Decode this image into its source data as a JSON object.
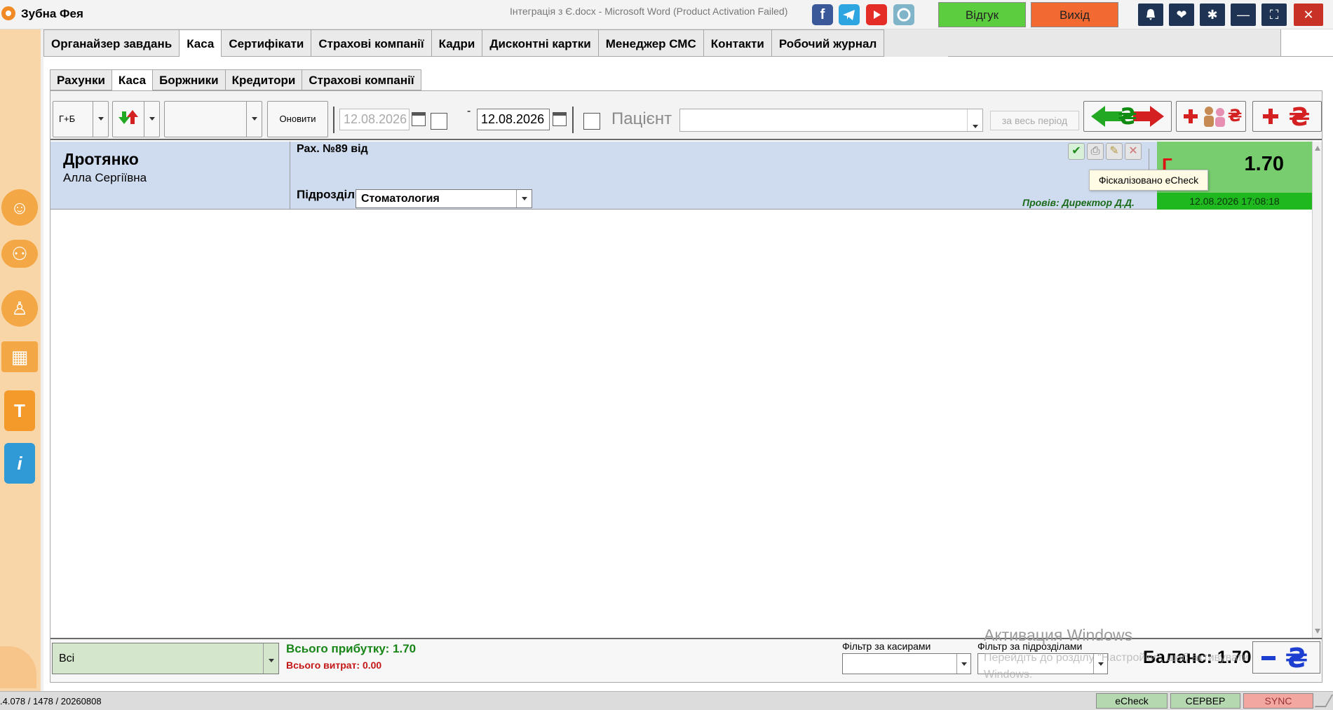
{
  "titlebar": {
    "app_name": "Зубна Фея",
    "window_title": "Інтеграція з Є.docx  -  Microsoft Word (Product Activation Failed)",
    "feedback_label": "Відгук",
    "exit_label": "Вихід",
    "feedback_color": "#5ccd3f",
    "exit_color": "#f26a32"
  },
  "main_tabs": [
    {
      "label": "Органайзер завдань"
    },
    {
      "label": "Каса",
      "active": true
    },
    {
      "label": "Сертифікати"
    },
    {
      "label": "Страхові компанії"
    },
    {
      "label": "Кадри"
    },
    {
      "label": "Дисконтні картки"
    },
    {
      "label": "Менеджер СМС"
    },
    {
      "label": "Контакти"
    },
    {
      "label": "Робочий журнал"
    }
  ],
  "sub_tabs": [
    {
      "label": "Рахунки"
    },
    {
      "label": "Каса",
      "active": true
    },
    {
      "label": "Боржники"
    },
    {
      "label": "Кредитори"
    },
    {
      "label": "Страхові компанії"
    }
  ],
  "toolbar": {
    "mode_label": "Г+Б",
    "refresh_label": "Оновити",
    "date_from": "12.08.2026",
    "date_separator": "-",
    "date_to": "12.08.2026",
    "patient_label": "Пацієнт",
    "all_period_label": "за весь період",
    "currency_glyph": "₴"
  },
  "record": {
    "surname": "Дротянко",
    "given_names": "Алла Сергіївна",
    "invoice_label": "Рах. №89 від",
    "unit_label": "Підрозділ:",
    "unit_value": "Стоматология",
    "conducted_by": "Провів: Директор Д.Д.",
    "amount": "1.70",
    "amount_mark": "Г",
    "datetime": "12.08.2026 17:08:18"
  },
  "tooltip": "Фіскалізовано eCheck",
  "footer": {
    "cashier_filter_value": "Всі",
    "total_profit": "Всього прибутку: 1.70",
    "total_cost": "Всього витрат: 0.00",
    "cashier_filter_label": "Фільтр за касирами",
    "unit_filter_label": "Фільтр за підрозділами",
    "balance": "Баланс: 1.70"
  },
  "watermark": {
    "title": "Активация Windows",
    "text": "Перейдіть до розділу \"Настройки\", щоб активувати Windows."
  },
  "statusbar": {
    "version": ".4.078 / 1478 / 20260808",
    "echeck_label": "eCheck",
    "server_label": "СЕРВЕР",
    "sync_label": "SYNC"
  }
}
